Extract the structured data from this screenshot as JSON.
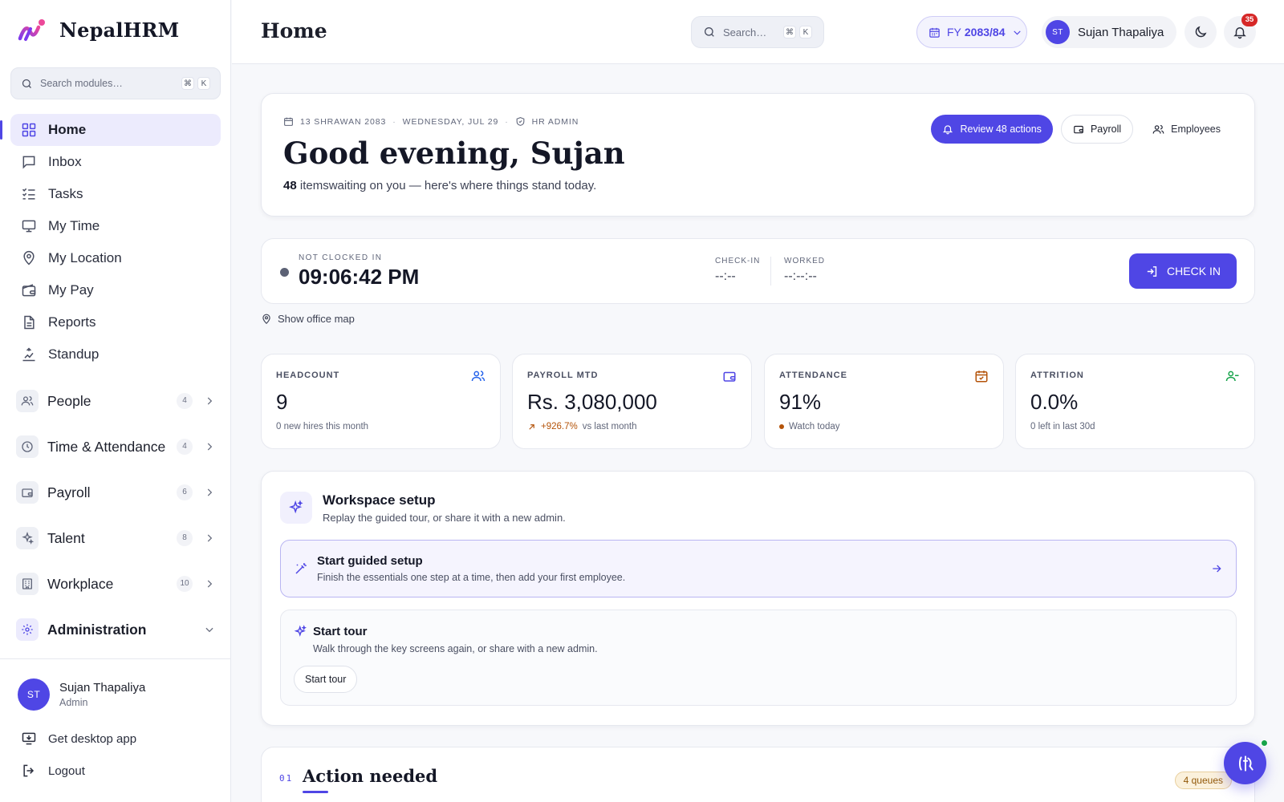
{
  "brand": {
    "name": "NepalHRM"
  },
  "sidebar": {
    "search_placeholder": "Search modules…",
    "kbd": [
      "⌘",
      "K"
    ],
    "nav": [
      {
        "label": "Home",
        "icon": "grid-icon",
        "active": true
      },
      {
        "label": "Inbox",
        "icon": "message-icon"
      },
      {
        "label": "Tasks",
        "icon": "tasks-icon"
      },
      {
        "label": "My Time",
        "icon": "monitor-icon"
      },
      {
        "label": "My Location",
        "icon": "map-pin-icon"
      },
      {
        "label": "My Pay",
        "icon": "wallet-icon"
      },
      {
        "label": "Reports",
        "icon": "document-icon"
      },
      {
        "label": "Standup",
        "icon": "standup-icon"
      }
    ],
    "groups": [
      {
        "label": "People",
        "count": "4",
        "icon": "people-icon"
      },
      {
        "label": "Time & Attendance",
        "count": "4",
        "icon": "clock-icon"
      },
      {
        "label": "Payroll",
        "count": "6",
        "icon": "wallet-icon"
      },
      {
        "label": "Talent",
        "count": "8",
        "icon": "sparkle-icon"
      },
      {
        "label": "Workplace",
        "count": "10",
        "icon": "building-icon"
      }
    ],
    "admin": {
      "label": "Administration",
      "icon": "gear-icon"
    },
    "user": {
      "initials": "ST",
      "name": "Sujan Thapaliya",
      "role": "Admin"
    },
    "desktop_app": "Get desktop app",
    "logout": "Logout"
  },
  "topbar": {
    "title": "Home",
    "search_placeholder": "Search…",
    "kbd": [
      "⌘",
      "K"
    ],
    "fy_prefix": "FY",
    "fy_value": "2083/84",
    "user_initials": "ST",
    "user_name": "Sujan Thapaliya",
    "notif_count": "35"
  },
  "welcome": {
    "date_np": "13 SHRAWAN 2083",
    "date_en": "WEDNESDAY, JUL 29",
    "role": "HR ADMIN",
    "greeting": "Good evening, Sujan",
    "pending_count": "48",
    "pending_text": "itemswaiting on you — here's where things stand today.",
    "review_btn": "Review 48 actions",
    "payroll_btn": "Payroll",
    "employees_btn": "Employees"
  },
  "clock": {
    "status": "NOT CLOCKED IN",
    "time": "09:06:42 PM",
    "checkin_label": "CHECK-IN",
    "checkin_value": "--:--",
    "worked_label": "WORKED",
    "worked_value": "--:--:--",
    "button": "CHECK IN",
    "map_link": "Show office map"
  },
  "stats": [
    {
      "label": "HEADCOUNT",
      "value": "9",
      "sub": "0 new hires this month",
      "icon": "people-icon",
      "color": "#2563eb"
    },
    {
      "label": "PAYROLL MTD",
      "value": "Rs. 3,080,000",
      "trend": "+926.7%",
      "sub": "vs last month",
      "icon": "wallet-icon",
      "color": "#4f46e5"
    },
    {
      "label": "ATTENDANCE",
      "value": "91%",
      "sub": "Watch today",
      "icon": "calendar-check-icon",
      "color": "#b45309"
    },
    {
      "label": "ATTRITION",
      "value": "0.0%",
      "sub": "0 left in last 30d",
      "icon": "user-minus-icon",
      "color": "#16a34a"
    }
  ],
  "setup": {
    "title": "Workspace setup",
    "subtitle": "Replay the guided tour, or share it with a new admin.",
    "guided_title": "Start guided setup",
    "guided_sub": "Finish the essentials one step at a time, then add your first employee.",
    "tour_title": "Start tour",
    "tour_sub": "Walk through the key screens again, or share with a new admin.",
    "tour_btn": "Start tour"
  },
  "action": {
    "number": "01",
    "title": "Action needed",
    "queues": "4 queues"
  },
  "colors": {
    "accent": "#4f46e5",
    "danger": "#d62828",
    "online": "#16a34a"
  }
}
